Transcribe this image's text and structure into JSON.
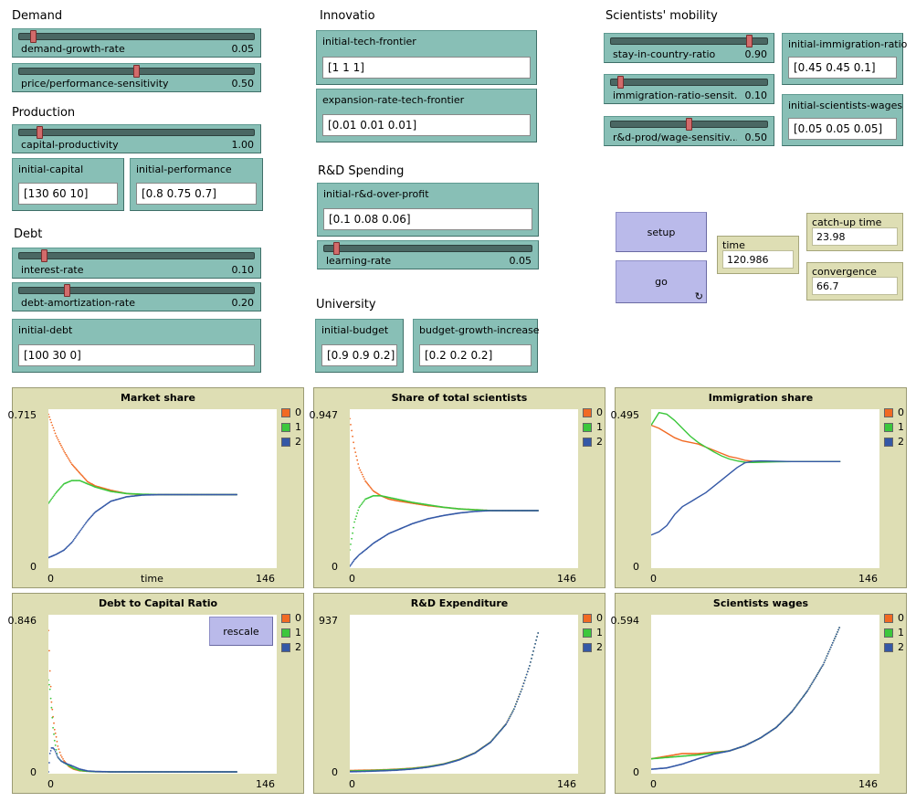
{
  "headings": {
    "demand": "Demand",
    "production": "Production",
    "debt": "Debt",
    "innovation": "Innovatio",
    "rd_spending": "R&D Spending",
    "university": "University",
    "mobility": "Scientists' mobility"
  },
  "sliders": {
    "demand_growth_rate": {
      "label": "demand-growth-rate",
      "value": "0.05",
      "level": 0.05
    },
    "price_performance_sensitivity": {
      "label": "price/performance-sensitivity",
      "value": "0.50",
      "level": 0.5
    },
    "capital_productivity": {
      "label": "capital-productivity",
      "value": "1.00",
      "level": 0.08
    },
    "interest_rate": {
      "label": "interest-rate",
      "value": "0.10",
      "level": 0.1
    },
    "debt_amortization_rate": {
      "label": "debt-amortization-rate",
      "value": "0.20",
      "level": 0.2
    },
    "learning_rate": {
      "label": "learning-rate",
      "value": "0.05",
      "level": 0.05
    },
    "stay_in_country_ratio": {
      "label": "stay-in-country-ratio",
      "value": "0.90",
      "level": 0.9
    },
    "immigration_ratio_sensitivity": {
      "label": "immigration-ratio-sensit...",
      "value": "0.10",
      "level": 0.05
    },
    "rd_prod_wage_sensitivity": {
      "label": "r&d-prod/wage-sensitiv...",
      "value": "0.50",
      "level": 0.5
    }
  },
  "inputs": {
    "initial_capital": {
      "label": "initial-capital",
      "value": "[130 60 10]"
    },
    "initial_performance": {
      "label": "initial-performance",
      "value": "[0.8 0.75 0.7]"
    },
    "initial_debt": {
      "label": "initial-debt",
      "value": "[100 30 0]"
    },
    "initial_tech_frontier": {
      "label": "initial-tech-frontier",
      "value": "[1 1 1]"
    },
    "expansion_rate_tech_frontier": {
      "label": "expansion-rate-tech-frontier",
      "value": "[0.01 0.01 0.01]"
    },
    "initial_rd_over_profit": {
      "label": "initial-r&d-over-profit",
      "value": "[0.1 0.08 0.06]"
    },
    "initial_budget": {
      "label": "initial-budget",
      "value": "[0.9 0.9 0.2]"
    },
    "budget_growth_increase": {
      "label": "budget-growth-increase",
      "value": "[0.2 0.2 0.2]"
    },
    "initial_immigration_ratio": {
      "label": "initial-immigration-ratio",
      "value": "[0.45 0.45 0.1]"
    },
    "initial_scientists_wages": {
      "label": "initial-scientists-wages",
      "value": "[0.05 0.05 0.05]"
    }
  },
  "buttons": {
    "setup": "setup",
    "go": "go",
    "go_icon": "forever-icon",
    "rescale": "rescale"
  },
  "monitors": {
    "time": {
      "label": "time",
      "value": "120.986"
    },
    "catch_up_time": {
      "label": "catch-up time",
      "value": "23.98"
    },
    "convergence_time": {
      "label": "convergence time",
      "value": "66.7"
    }
  },
  "legend": {
    "labels": [
      "0",
      "1",
      "2"
    ],
    "colors": [
      "#f16a23",
      "#3cc73c",
      "#3458a6"
    ]
  },
  "chart_data": [
    {
      "type": "scatter",
      "title": "Market share",
      "ymax_label": "0.715",
      "ymin_label": "0",
      "xmin_label": "0",
      "xmax_label": "146",
      "xlabel": "time",
      "xlim": [
        0,
        146
      ],
      "ylim": [
        0,
        0.715
      ],
      "series": [
        {
          "name": "0",
          "x": [
            0,
            5,
            10,
            15,
            20,
            25,
            30,
            40,
            50,
            60,
            70,
            80,
            90,
            100,
            110,
            121
          ],
          "y": [
            0.7,
            0.6,
            0.53,
            0.47,
            0.43,
            0.39,
            0.37,
            0.35,
            0.335,
            0.33,
            0.33,
            0.33,
            0.33,
            0.33,
            0.33,
            0.33
          ]
        },
        {
          "name": "1",
          "x": [
            0,
            5,
            10,
            15,
            20,
            25,
            30,
            40,
            50,
            60,
            70,
            80,
            90,
            100,
            110,
            121
          ],
          "y": [
            0.29,
            0.34,
            0.38,
            0.395,
            0.395,
            0.38,
            0.365,
            0.345,
            0.335,
            0.332,
            0.33,
            0.33,
            0.33,
            0.33,
            0.33,
            0.33
          ]
        },
        {
          "name": "2",
          "x": [
            0,
            5,
            10,
            15,
            20,
            25,
            30,
            40,
            50,
            60,
            70,
            80,
            90,
            100,
            110,
            121
          ],
          "y": [
            0.04,
            0.055,
            0.075,
            0.11,
            0.16,
            0.21,
            0.25,
            0.3,
            0.32,
            0.328,
            0.33,
            0.33,
            0.33,
            0.33,
            0.33,
            0.33
          ]
        }
      ]
    },
    {
      "type": "scatter",
      "title": "Share of total scientists",
      "ymax_label": "0.947",
      "ymin_label": "0",
      "xmin_label": "0",
      "xmax_label": "146",
      "xlabel": "",
      "xlim": [
        0,
        146
      ],
      "ylim": [
        0,
        0.947
      ],
      "series": [
        {
          "name": "0",
          "x": [
            0,
            3,
            6,
            10,
            15,
            20,
            25,
            30,
            40,
            50,
            60,
            70,
            80,
            90,
            100,
            110,
            121
          ],
          "y": [
            0.9,
            0.72,
            0.6,
            0.52,
            0.46,
            0.43,
            0.41,
            0.4,
            0.385,
            0.37,
            0.36,
            0.35,
            0.345,
            0.34,
            0.34,
            0.34,
            0.34
          ]
        },
        {
          "name": "1",
          "x": [
            0,
            3,
            6,
            10,
            15,
            20,
            25,
            30,
            40,
            50,
            60,
            70,
            80,
            90,
            100,
            110,
            121
          ],
          "y": [
            0.1,
            0.27,
            0.36,
            0.41,
            0.43,
            0.43,
            0.42,
            0.41,
            0.39,
            0.375,
            0.36,
            0.35,
            0.345,
            0.34,
            0.34,
            0.34,
            0.34
          ]
        },
        {
          "name": "2",
          "x": [
            0,
            3,
            6,
            10,
            15,
            20,
            25,
            30,
            40,
            50,
            60,
            70,
            80,
            90,
            100,
            110,
            121
          ],
          "y": [
            0.0,
            0.04,
            0.07,
            0.1,
            0.14,
            0.17,
            0.2,
            0.22,
            0.26,
            0.29,
            0.31,
            0.325,
            0.335,
            0.34,
            0.34,
            0.34,
            0.34
          ]
        }
      ]
    },
    {
      "type": "line",
      "title": "Immigration share",
      "ymax_label": "0.495",
      "ymin_label": "0",
      "xmin_label": "0",
      "xmax_label": "146",
      "xlabel": "",
      "xlim": [
        0,
        146
      ],
      "ylim": [
        0,
        0.495
      ],
      "series": [
        {
          "name": "0",
          "x": [
            0,
            5,
            10,
            15,
            20,
            25,
            30,
            35,
            40,
            45,
            50,
            55,
            60,
            65,
            70,
            80,
            90,
            100,
            110,
            121
          ],
          "y": [
            0.45,
            0.44,
            0.425,
            0.41,
            0.4,
            0.395,
            0.39,
            0.38,
            0.37,
            0.36,
            0.35,
            0.345,
            0.338,
            0.335,
            0.334,
            0.334,
            0.334,
            0.334,
            0.334,
            0.334
          ]
        },
        {
          "name": "1",
          "x": [
            0,
            5,
            10,
            15,
            20,
            25,
            30,
            35,
            40,
            45,
            50,
            55,
            60,
            65,
            70,
            80,
            90,
            100,
            110,
            121
          ],
          "y": [
            0.45,
            0.49,
            0.485,
            0.465,
            0.44,
            0.415,
            0.395,
            0.38,
            0.365,
            0.352,
            0.342,
            0.336,
            0.332,
            0.331,
            0.332,
            0.333,
            0.334,
            0.334,
            0.334,
            0.334
          ]
        },
        {
          "name": "2",
          "x": [
            0,
            5,
            10,
            15,
            20,
            25,
            30,
            35,
            40,
            45,
            50,
            55,
            60,
            65,
            70,
            80,
            90,
            100,
            110,
            121
          ],
          "y": [
            0.1,
            0.11,
            0.13,
            0.165,
            0.19,
            0.205,
            0.22,
            0.235,
            0.255,
            0.275,
            0.295,
            0.315,
            0.33,
            0.335,
            0.336,
            0.335,
            0.334,
            0.334,
            0.334,
            0.334
          ]
        }
      ]
    },
    {
      "type": "scatter",
      "title": "Debt to Capital Ratio",
      "ymax_label": "0.846",
      "ymin_label": "0",
      "xmin_label": "0",
      "xmax_label": "146",
      "xlabel": "",
      "xlim": [
        0,
        146
      ],
      "ylim": [
        0,
        0.846
      ],
      "series": [
        {
          "name": "0",
          "x": [
            0,
            1,
            2,
            3,
            4,
            5,
            6,
            8,
            10,
            13,
            16,
            20,
            25,
            30,
            40,
            60,
            80,
            100,
            121
          ],
          "y": [
            0.77,
            0.55,
            0.38,
            0.3,
            0.23,
            0.19,
            0.14,
            0.09,
            0.06,
            0.03,
            0.015,
            0.006,
            0.003,
            0.001,
            0.0,
            0.0,
            0.0,
            0.0,
            0.0
          ]
        },
        {
          "name": "1",
          "x": [
            0,
            1,
            2,
            3,
            4,
            5,
            6,
            8,
            10,
            13,
            16,
            20,
            25,
            30,
            40,
            60,
            80,
            100,
            121
          ],
          "y": [
            0.5,
            0.45,
            0.35,
            0.24,
            0.17,
            0.12,
            0.08,
            0.06,
            0.05,
            0.035,
            0.02,
            0.008,
            0.003,
            0.001,
            0.0,
            0.0,
            0.0,
            0.0,
            0.0
          ]
        },
        {
          "name": "2",
          "x": [
            0,
            1,
            2,
            3,
            4,
            5,
            6,
            8,
            10,
            13,
            16,
            20,
            25,
            30,
            40,
            60,
            80,
            100,
            121
          ],
          "y": [
            0.0,
            0.1,
            0.13,
            0.13,
            0.12,
            0.1,
            0.08,
            0.06,
            0.05,
            0.04,
            0.03,
            0.015,
            0.005,
            0.002,
            0.0,
            0.0,
            0.0,
            0.0,
            0.0
          ]
        }
      ]
    },
    {
      "type": "scatter",
      "title": "R&D Expenditure",
      "ymax_label": "937",
      "ymin_label": "0",
      "xmin_label": "0",
      "xmax_label": "146",
      "xlabel": "",
      "xlim": [
        0,
        146
      ],
      "ylim": [
        0,
        937
      ],
      "series": [
        {
          "name": "0",
          "x": [
            0,
            10,
            20,
            30,
            40,
            50,
            60,
            70,
            80,
            90,
            100,
            105,
            110,
            115,
            121
          ],
          "y": [
            8,
            10,
            12,
            16,
            22,
            32,
            48,
            75,
            115,
            180,
            290,
            380,
            500,
            640,
            860
          ]
        },
        {
          "name": "1",
          "x": [
            0,
            10,
            20,
            30,
            40,
            50,
            60,
            70,
            80,
            90,
            100,
            105,
            110,
            115,
            121
          ],
          "y": [
            5,
            7,
            10,
            14,
            20,
            31,
            47,
            74,
            114,
            179,
            289,
            379,
            499,
            640,
            860
          ]
        },
        {
          "name": "2",
          "x": [
            0,
            10,
            20,
            30,
            40,
            50,
            60,
            70,
            80,
            90,
            100,
            105,
            110,
            115,
            121
          ],
          "y": [
            1,
            3,
            6,
            10,
            17,
            28,
            45,
            72,
            113,
            178,
            288,
            378,
            498,
            640,
            860
          ]
        }
      ]
    },
    {
      "type": "scatter",
      "title": "Scientists wages",
      "ymax_label": "0.594",
      "ymin_label": "0",
      "xmin_label": "0",
      "xmax_label": "146",
      "xlabel": "",
      "xlim": [
        0,
        146
      ],
      "ylim": [
        0,
        0.594
      ],
      "series": [
        {
          "name": "0",
          "x": [
            0,
            10,
            20,
            30,
            40,
            50,
            60,
            70,
            80,
            90,
            100,
            110,
            121
          ],
          "y": [
            0.05,
            0.06,
            0.07,
            0.07,
            0.075,
            0.08,
            0.1,
            0.13,
            0.17,
            0.23,
            0.31,
            0.41,
            0.56
          ]
        },
        {
          "name": "1",
          "x": [
            0,
            10,
            20,
            30,
            40,
            50,
            60,
            70,
            80,
            90,
            100,
            110,
            121
          ],
          "y": [
            0.05,
            0.055,
            0.06,
            0.065,
            0.072,
            0.08,
            0.1,
            0.13,
            0.17,
            0.23,
            0.31,
            0.41,
            0.56
          ]
        },
        {
          "name": "2",
          "x": [
            0,
            10,
            20,
            30,
            40,
            50,
            60,
            70,
            80,
            90,
            100,
            110,
            121
          ],
          "y": [
            0.01,
            0.015,
            0.03,
            0.05,
            0.068,
            0.08,
            0.1,
            0.13,
            0.17,
            0.23,
            0.31,
            0.41,
            0.56
          ]
        }
      ]
    }
  ]
}
